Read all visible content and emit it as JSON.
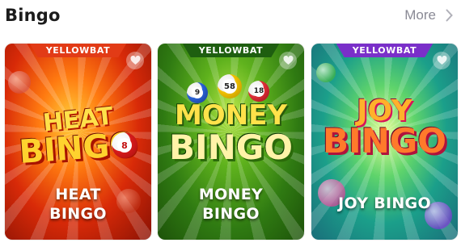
{
  "section": {
    "title": "Bingo",
    "more_label": "More"
  },
  "games": [
    {
      "provider": "YELLOWBAT",
      "logo_line1": "HEAT",
      "logo_line2": "BINGO",
      "title_line1": "HEAT",
      "title_line2": "BINGO",
      "ball_number": "8",
      "accent": "#e23b16"
    },
    {
      "provider": "YELLOWBAT",
      "logo_line1": "MONEY",
      "logo_line2": "BINGO",
      "title_line1": "MONEY",
      "title_line2": "BINGO",
      "ball_numbers": [
        "9",
        "58",
        "18"
      ],
      "accent": "#2f7a12"
    },
    {
      "provider": "YELLOWBAT",
      "logo_line1": "JOY",
      "logo_line2": "BINGO",
      "title_line1": "JOY BINGO",
      "accent": "#7a2fc9"
    }
  ],
  "icons": {
    "more": "chevron-right-icon",
    "favorite": "heart-icon"
  }
}
